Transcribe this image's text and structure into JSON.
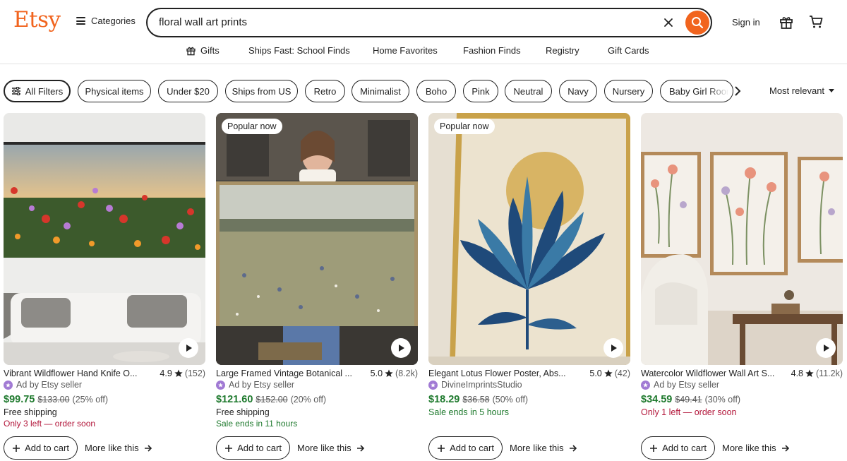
{
  "header": {
    "logo": "Etsy",
    "categories_label": "Categories",
    "search_value": "floral wall art prints",
    "signin_label": "Sign in",
    "accent_color": "#F1641E"
  },
  "subnav": [
    "Gifts",
    "Ships Fast: School Finds",
    "Home Favorites",
    "Fashion Finds",
    "Registry",
    "Gift Cards"
  ],
  "filters": {
    "all_filters": "All Filters",
    "chips": [
      "Physical items",
      "Under $20",
      "Ships from US",
      "Retro",
      "Minimalist",
      "Boho",
      "Pink",
      "Neutral",
      "Navy",
      "Nursery",
      "Baby Girl Room"
    ],
    "sort_label": "Most relevant"
  },
  "listings": [
    {
      "badge": "",
      "title": "Vibrant Wildflower Hand Knife O...",
      "rating": "4.9",
      "reviews": "(152)",
      "seller": "Ad by Etsy seller",
      "price": "$99.75",
      "original_price": "$133.00",
      "discount": "(25% off)",
      "line1": "Free shipping",
      "line2": "Only 3 left — order soon"
    },
    {
      "badge": "Popular now",
      "title": "Large Framed Vintage Botanical ...",
      "rating": "5.0",
      "reviews": "(8.2k)",
      "seller": "Ad by Etsy seller",
      "price": "$121.60",
      "original_price": "$152.00",
      "discount": "(20% off)",
      "line1": "Free shipping",
      "line2": "Sale ends in 11 hours"
    },
    {
      "badge": "Popular now",
      "title": "Elegant Lotus Flower Poster, Abs...",
      "rating": "5.0",
      "reviews": "(42)",
      "seller": "DivineImprintsStudio",
      "price": "$18.29",
      "original_price": "$36.58",
      "discount": "(50% off)",
      "line1": "Sale ends in 5 hours",
      "line2": ""
    },
    {
      "badge": "",
      "title": "Watercolor Wildflower Wall Art S...",
      "rating": "4.8",
      "reviews": "(11.2k)",
      "seller": "Ad by Etsy seller",
      "price": "$34.59",
      "original_price": "$49.41",
      "discount": "(30% off)",
      "line1": "Only 1 left — order soon",
      "line2": ""
    }
  ],
  "card_actions": {
    "add_to_cart": "Add to cart",
    "more_like_this": "More like this"
  }
}
